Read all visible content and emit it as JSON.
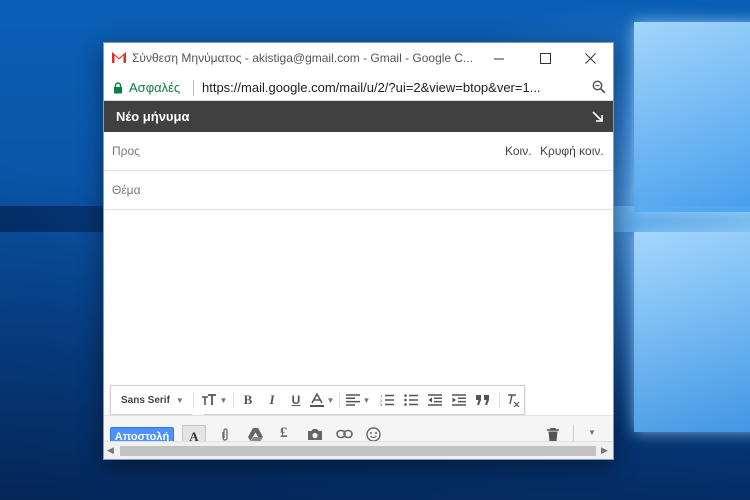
{
  "window": {
    "title": "Σύνθεση Μηνύματος - akistiga@gmail.com - Gmail - Google C...",
    "minimize_label": "—",
    "maximize_label": "☐",
    "close_label": "✕"
  },
  "addressbar": {
    "secure_label": "Ασφαλές",
    "url": "https://mail.google.com/mail/u/2/?ui=2&view=btop&ver=1..."
  },
  "compose": {
    "title": "Νέο μήνυμα",
    "to_label": "Προς",
    "cc_label": "Κοιν.",
    "bcc_label": "Κρυφή κοιν.",
    "subject_label": "Θέμα"
  },
  "format_toolbar": {
    "font_name": "Sans Serif"
  },
  "bottom_bar": {
    "send_label": "Αποστολή",
    "format_toggle_label": "A"
  },
  "colors": {
    "compose_header": "#404040",
    "send_button": "#4d90fe",
    "secure_green": "#0b8043",
    "gmail_red": "#d93025"
  }
}
